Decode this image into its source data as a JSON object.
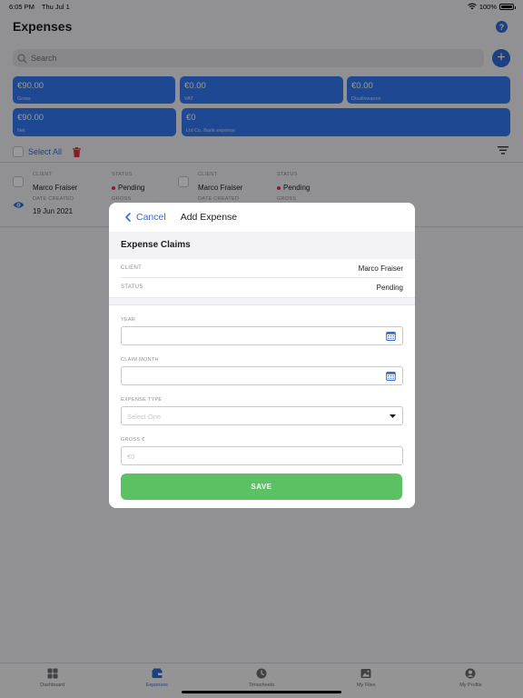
{
  "status_bar": {
    "time": "6:05 PM",
    "date": "Thu Jul 1",
    "battery": "100%"
  },
  "header": {
    "title": "Expenses",
    "help_icon": "?"
  },
  "search": {
    "placeholder": "Search",
    "add_label": "+"
  },
  "summary_cards": [
    {
      "value": "€90.00",
      "label": "Gross"
    },
    {
      "value": "€0.00",
      "label": "VAT"
    },
    {
      "value": "€0.00",
      "label": "Disallowance"
    },
    {
      "value": "€90.00",
      "label": "Net"
    },
    {
      "value": "€0",
      "label": "Ltd Co. Bank expense"
    }
  ],
  "select_bar": {
    "select_all": "Select All"
  },
  "list_items": [
    {
      "client_label": "CLIENT",
      "client": "Marco Fraiser",
      "status_label": "STATUS",
      "status": "Pending",
      "date_label": "DATE CREATED",
      "date": "19 Jun 2021",
      "gross_label": "GROSS"
    },
    {
      "client_label": "CLIENT",
      "client": "Marco Fraiser",
      "status_label": "STATUS",
      "status": "Pending",
      "date_label": "DATE CREATED",
      "gross_label": "GROSS"
    }
  ],
  "modal": {
    "cancel": "Cancel",
    "title": "Add Expense",
    "section": "Expense Claims",
    "client_label": "CLIENT",
    "client_value": "Marco Fraiser",
    "status_label": "STATUS",
    "status_value": "Pending",
    "year_label": "YEAR",
    "claim_month_label": "CLAIM MONTH",
    "expense_type_label": "EXPENSE TYPE",
    "expense_type_placeholder": "Select One",
    "gross_label": "GROSS €",
    "gross_placeholder": "€0",
    "save": "SAVE"
  },
  "tabs": [
    {
      "label": "Dashboard",
      "icon": "dashboard-icon",
      "active": false
    },
    {
      "label": "Expenses",
      "icon": "expenses-icon",
      "active": true
    },
    {
      "label": "Timesheets",
      "icon": "clock-icon",
      "active": false
    },
    {
      "label": "My Files",
      "icon": "files-icon",
      "active": false
    },
    {
      "label": "My Profile",
      "icon": "profile-icon",
      "active": false
    }
  ],
  "colors": {
    "accent": "#2f6bd9",
    "card": "#3478f6",
    "save": "#5cc162",
    "status_dot": "#e0313b"
  }
}
